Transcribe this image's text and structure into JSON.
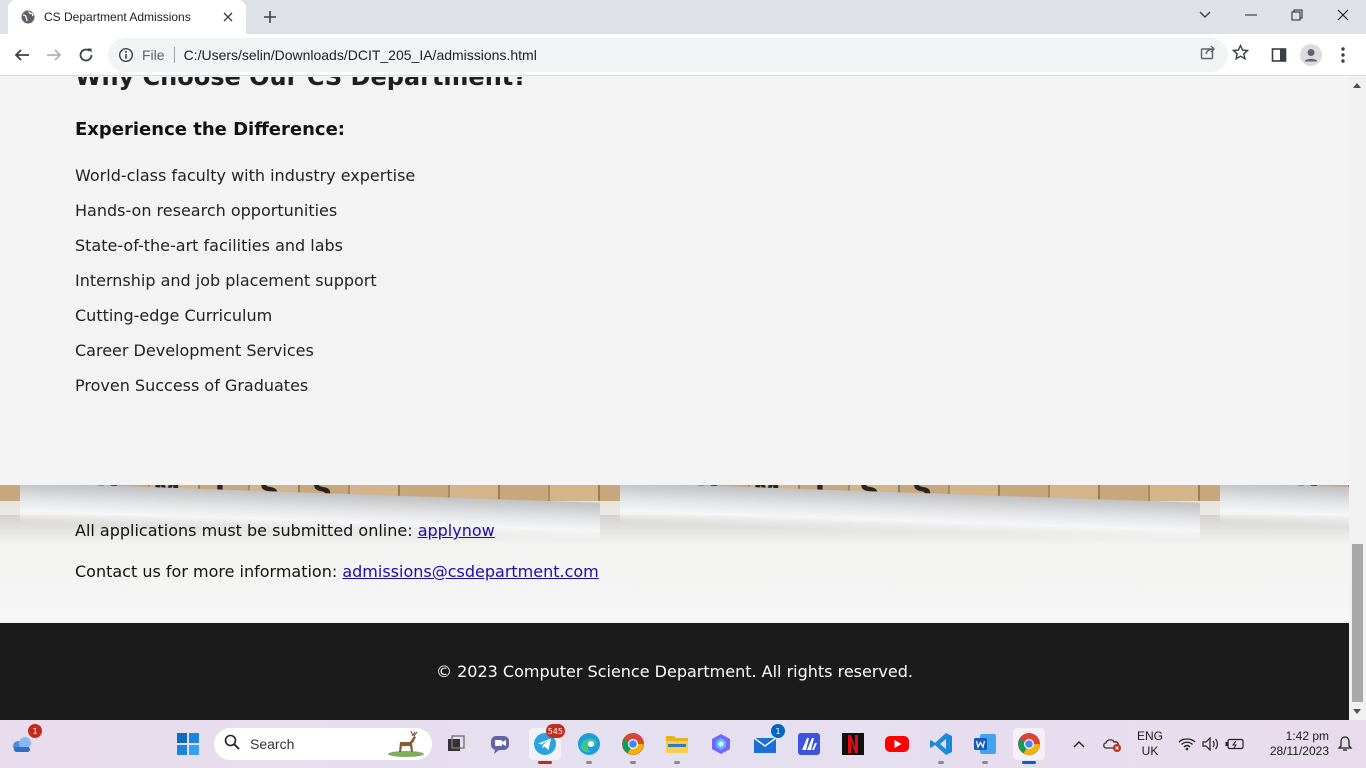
{
  "browser": {
    "tab_title": "CS Department Admissions",
    "scheme_label": "File",
    "url": "C:/Users/selin/Downloads/DCIT_205_IA/admissions.html"
  },
  "page": {
    "section_heading": "Why Choose Our CS Department?",
    "sub_heading": "Experience the Difference:",
    "benefits": [
      "World-class faculty with industry expertise",
      "Hands-on research opportunities",
      "State-of-the-art facilities and labs",
      "Internship and job placement support",
      "Cutting-edge Curriculum",
      "Career Development Services",
      "Proven Success of Graduates"
    ],
    "apply_text": "All applications must be submitted online: ",
    "apply_link": "applynow",
    "contact_text": "Contact us for more information: ",
    "contact_link": "admissions@csdepartment.com",
    "footer": "© 2023 Computer Science Department. All rights reserved."
  },
  "taskbar": {
    "widgets_badge": "1",
    "search_label": "Search",
    "telegram_badge": "545",
    "mail_badge": "1",
    "lang_top": "ENG",
    "lang_bottom": "UK",
    "time": "1:42 pm",
    "date": "28/11/2023"
  },
  "colors": {
    "link": "#1a0dab",
    "footer_bg": "#1b1b1b",
    "page_bg": "#f3f3f3"
  }
}
